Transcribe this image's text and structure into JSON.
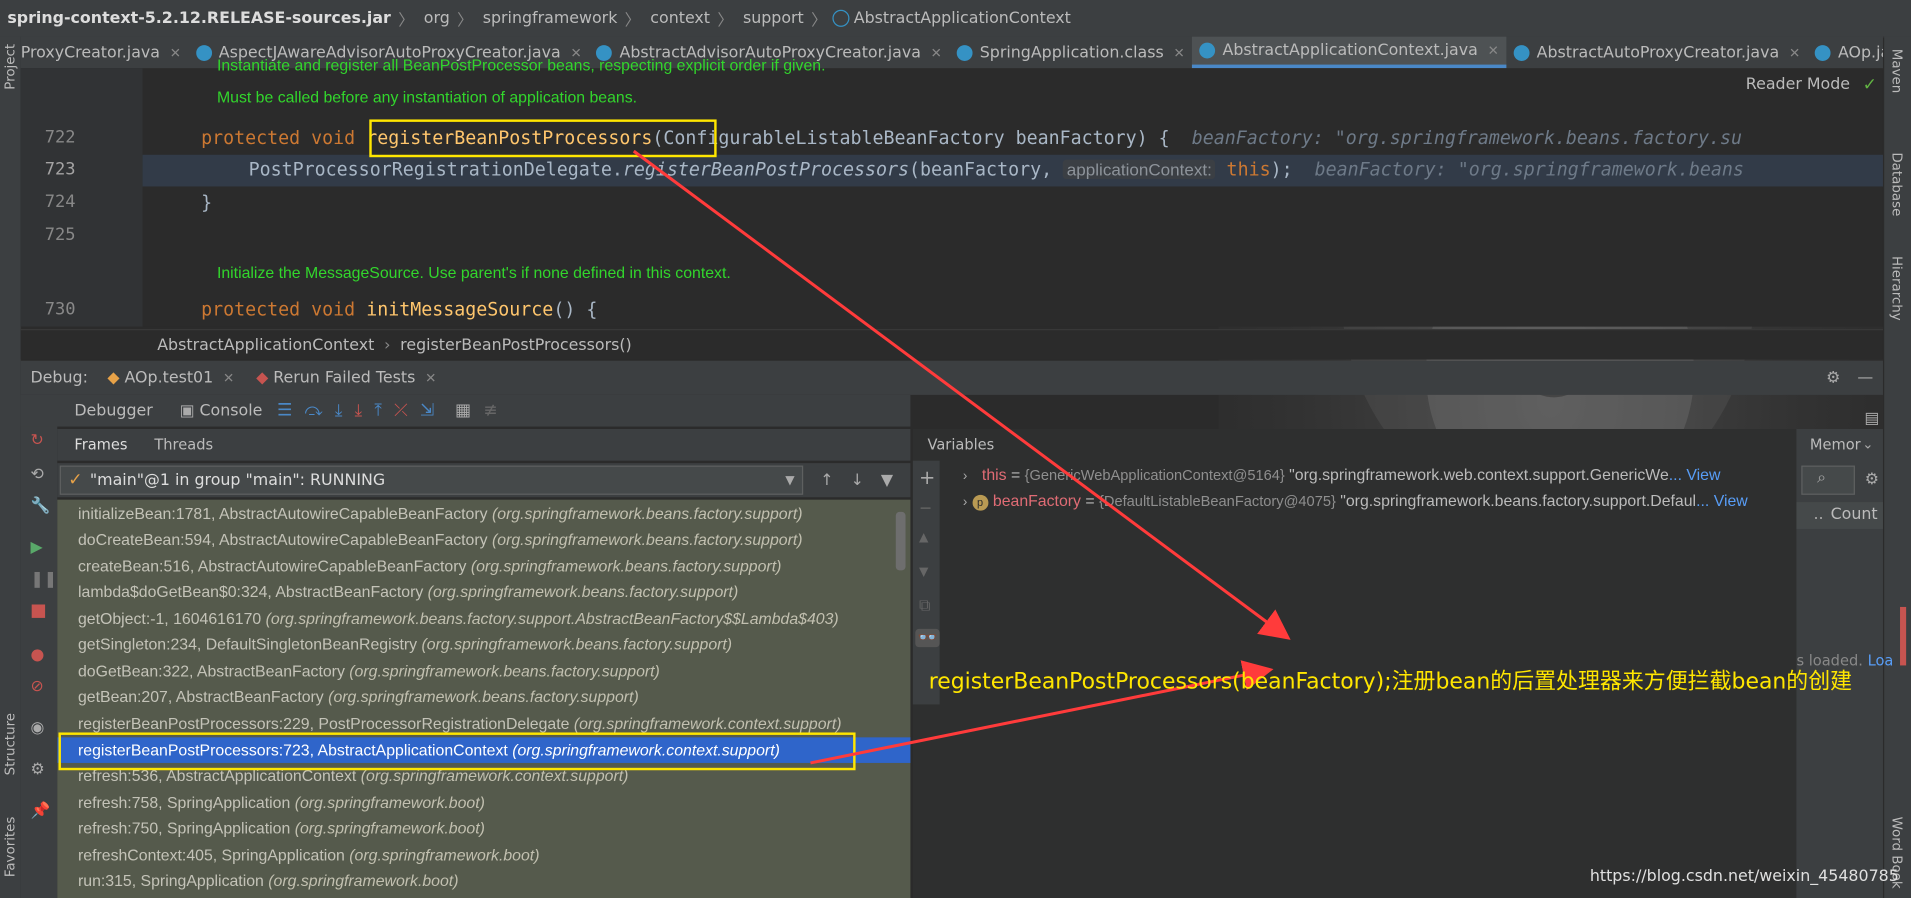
{
  "breadcrumb": {
    "jar": "spring-context-5.2.12.RELEASE-sources.jar",
    "parts": [
      "org",
      "springframework",
      "context",
      "support"
    ],
    "class": "AbstractApplicationContext"
  },
  "tabs": [
    {
      "label": "ProxyCreator.java",
      "active": false
    },
    {
      "label": "AspectJAwareAdvisorAutoProxyCreator.java",
      "active": false
    },
    {
      "label": "AbstractAdvisorAutoProxyCreator.java",
      "active": false
    },
    {
      "label": "SpringApplication.class",
      "active": false
    },
    {
      "label": "AbstractApplicationContext.java",
      "active": true
    },
    {
      "label": "AbstractAutoProxyCreator.java",
      "active": false
    },
    {
      "label": "AOp.java",
      "active": false
    }
  ],
  "editor": {
    "reader_mode": "Reader Mode",
    "doc1a": "Instantiate and register all BeanPostProcessor beans, respecting explicit order if given.",
    "doc1b": "Must be called before any instantiation of application beans.",
    "line722": "722",
    "line723": "723",
    "line724": "724",
    "line725": "725",
    "line730": "730",
    "kw_protected": "protected",
    "kw_void": "void",
    "method1": "registerBeanPostProcessors",
    "params1": "(ConfigurableListableBeanFactory beanFactory) {",
    "hint1": "beanFactory: \"org.springframework.beans.factory.su",
    "call_owner": "PostProcessorRegistrationDelegate.",
    "call_method": "registerBeanPostProcessors",
    "call_args": "(beanFactory,",
    "inlay": "applicationContext:",
    "kw_this": "this",
    "call_end": ");",
    "hint2": "beanFactory: \"org.springframework.beans",
    "close_brace": "}",
    "doc2": "Initialize the MessageSource. Use parent's if none defined in this context.",
    "method2": "initMessageSource",
    "method2_tail": "() {"
  },
  "editor_crumb": [
    "AbstractApplicationContext",
    "registerBeanPostProcessors()"
  ],
  "debug": {
    "label": "Debug:",
    "session1": "AOp.test01",
    "session2": "Rerun Failed Tests",
    "debugger_tab": "Debugger",
    "console_tab": "Console",
    "frames_tab": "Frames",
    "threads_tab": "Threads",
    "thread": "\"main\"@1 in group \"main\": RUNNING",
    "variables": "Variables",
    "memory": "Memor",
    "count": "Count",
    "loaded": "s loaded.",
    "load_link": "Loa"
  },
  "frames": [
    {
      "name": "initializeBean:1781, AbstractAutowireCapableBeanFactory",
      "pkg": "(org.springframework.beans.factory.support)"
    },
    {
      "name": "doCreateBean:594, AbstractAutowireCapableBeanFactory",
      "pkg": "(org.springframework.beans.factory.support)"
    },
    {
      "name": "createBean:516, AbstractAutowireCapableBeanFactory",
      "pkg": "(org.springframework.beans.factory.support)"
    },
    {
      "name": "lambda$doGetBean$0:324, AbstractBeanFactory",
      "pkg": "(org.springframework.beans.factory.support)"
    },
    {
      "name": "getObject:-1, 1604616170",
      "pkg": "(org.springframework.beans.factory.support.AbstractBeanFactory$$Lambda$403)"
    },
    {
      "name": "getSingleton:234, DefaultSingletonBeanRegistry",
      "pkg": "(org.springframework.beans.factory.support)"
    },
    {
      "name": "doGetBean:322, AbstractBeanFactory",
      "pkg": "(org.springframework.beans.factory.support)"
    },
    {
      "name": "getBean:207, AbstractBeanFactory",
      "pkg": "(org.springframework.beans.factory.support)"
    },
    {
      "name": "registerBeanPostProcessors:229, PostProcessorRegistrationDelegate",
      "pkg": "(org.springframework.context.support)"
    },
    {
      "name": "registerBeanPostProcessors:723, AbstractApplicationContext",
      "pkg": "(org.springframework.context.support)",
      "selected": true
    },
    {
      "name": "refresh:536, AbstractApplicationContext",
      "pkg": "(org.springframework.context.support)"
    },
    {
      "name": "refresh:758, SpringApplication",
      "pkg": "(org.springframework.boot)"
    },
    {
      "name": "refresh:750, SpringApplication",
      "pkg": "(org.springframework.boot)"
    },
    {
      "name": "refreshContext:405, SpringApplication",
      "pkg": "(org.springframework.boot)"
    },
    {
      "name": "run:315, SpringApplication",
      "pkg": "(org.springframework.boot)"
    }
  ],
  "variables": [
    {
      "name": "this",
      "eq": " = ",
      "ref": "{GenericWebApplicationContext@5164}",
      "val": " \"org.springframework.web.context.support.GenericWe",
      "link": "... View"
    },
    {
      "name": "beanFactory",
      "eq": " = ",
      "ref": "{DefaultListableBeanFactory@4075}",
      "val": " \"org.springframework.beans.factory.support.Defaul",
      "link": "... View"
    }
  ],
  "annotation": "registerBeanPostProcessors(beanFactory);注册bean的后置处理器来方便拦截bean的创建",
  "watermark": "https://blog.csdn.net/weixin_45480785",
  "side_labels": {
    "project": "Project",
    "structure": "Structure",
    "favorites": "Favorites",
    "maven": "Maven",
    "database": "Database",
    "hierarchy": "Hierarchy",
    "word_book": "Word Book"
  },
  "colors": {
    "highlight_box": "#ffe600",
    "arrow": "#ff3b3b",
    "selected_frame": "#2f65ca",
    "doc_text": "#32d62c"
  }
}
